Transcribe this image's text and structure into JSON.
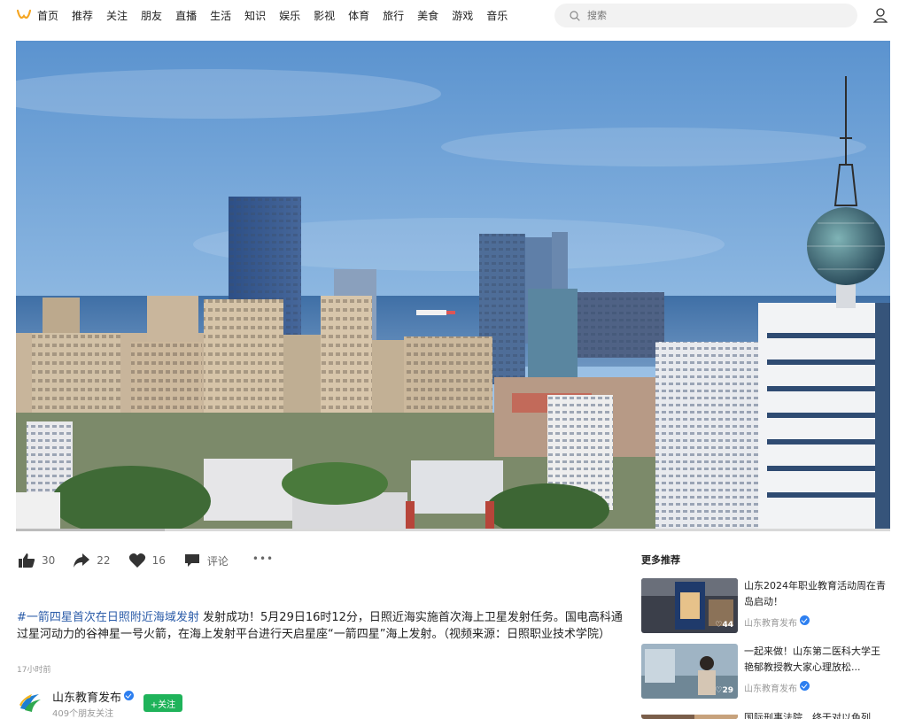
{
  "nav": {
    "items": [
      "首页",
      "推荐",
      "关注",
      "朋友",
      "直播",
      "生活",
      "知识",
      "娱乐",
      "影视",
      "体育",
      "旅行",
      "美食",
      "游戏",
      "音乐"
    ],
    "search_placeholder": "搜索"
  },
  "video": {
    "progress": 0.17
  },
  "actions": {
    "likes": "30",
    "shares": "22",
    "favorites": "16",
    "comment_label": "评论",
    "more": "•••"
  },
  "post": {
    "hashtag": "#一箭四星首次在日照附近海域发射",
    "text": " 发射成功！5月29日16时12分，日照近海实施首次海上卫星发射任务。国电高科通过星河动力的谷神星一号火箭，在海上发射平台进行天启星座“一箭四星”海上发射。（视频来源：日照职业技术学院）",
    "time": "17小时前"
  },
  "author": {
    "name": "山东教育发布",
    "sub": "409个朋友关注",
    "follow_label": "+关注"
  },
  "recommend": {
    "title": "更多推荐",
    "items": [
      {
        "title": "山东2024年职业教育活动周在青岛启动！",
        "source": "山东教育发布",
        "count": "44"
      },
      {
        "title": "一起来做！山东第二医科大学王艳郁教授教大家心理放松...",
        "source": "山东教育发布",
        "count": "29"
      },
      {
        "title": "国际刑事法院、终于对以色列",
        "source": "",
        "count": ""
      }
    ]
  },
  "colors": {
    "accent": "#1fb35a",
    "link": "#2a5ba8",
    "logo": "#f5a623",
    "verify": "#2d7ff0"
  }
}
